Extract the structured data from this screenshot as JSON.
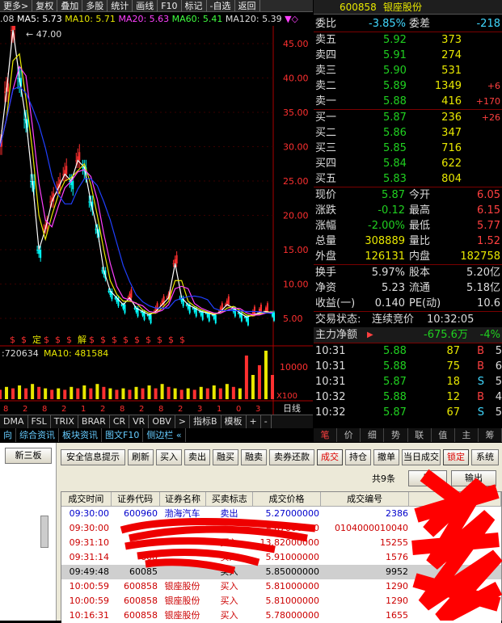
{
  "toolbar": {
    "items": [
      "更多>",
      "复权",
      "叠加",
      "多股",
      "统计",
      "画线",
      "F10",
      "标记",
      "-自选",
      "返回"
    ]
  },
  "ma_legend": {
    "prefix": ".08",
    "ma5": "MA5: 5.73",
    "ma10": "MA10: 5.71",
    "ma20": "MA20: 5.63",
    "ma60": "MA60: 5.41",
    "ma120": "MA120: 5.39"
  },
  "chart_data": {
    "type": "candlestick",
    "price_axis": {
      "ticks": [
        "45.00",
        "40.00",
        "35.00",
        "30.00",
        "25.00",
        "20.00",
        "15.00",
        "10.00",
        "5.00"
      ]
    },
    "volume_axis": {
      "ticks": [
        "10000",
        "X100"
      ]
    },
    "high_label": "47.00",
    "volume_legend": {
      "vol": "720634",
      "ma10": "MA10: 481584"
    },
    "price_path": [
      [
        0,
        30
      ],
      [
        1,
        38
      ],
      [
        2,
        47
      ],
      [
        3,
        40
      ],
      [
        4,
        34
      ],
      [
        5,
        25
      ],
      [
        6,
        15
      ],
      [
        7,
        18
      ],
      [
        8,
        22
      ],
      [
        9,
        24
      ],
      [
        10,
        26
      ],
      [
        11,
        25
      ],
      [
        12,
        28
      ],
      [
        13,
        27
      ],
      [
        14,
        22
      ],
      [
        15,
        18
      ],
      [
        16,
        12
      ],
      [
        17,
        9
      ],
      [
        18,
        8
      ],
      [
        19,
        7
      ],
      [
        20,
        8
      ],
      [
        21,
        6.5
      ],
      [
        22,
        6
      ],
      [
        23,
        5.5
      ],
      [
        24,
        6
      ],
      [
        25,
        7
      ],
      [
        26,
        8
      ],
      [
        27,
        13
      ],
      [
        28,
        8
      ],
      [
        29,
        7
      ],
      [
        30,
        6.5
      ],
      [
        31,
        6
      ],
      [
        32,
        5.8
      ],
      [
        33,
        5.5
      ],
      [
        34,
        6
      ],
      [
        35,
        7
      ],
      [
        36,
        6.5
      ],
      [
        37,
        5.8
      ],
      [
        38,
        5.2
      ],
      [
        39,
        5.5
      ],
      [
        40,
        5.8
      ],
      [
        41,
        6
      ],
      [
        42,
        5.87
      ]
    ],
    "bottom_markers": [
      "$",
      "$",
      "定",
      "$",
      "$",
      "$",
      "解",
      "$",
      "$",
      "$",
      "$",
      "$",
      "$",
      "$",
      "$",
      "$"
    ],
    "date_ticks": [
      "8",
      "2",
      "8",
      "2",
      "1",
      "2",
      "8",
      "2",
      "8",
      "2",
      "3",
      "1",
      "0",
      "3"
    ],
    "side_tick": "日线"
  },
  "indicator_tabs": [
    "DMA",
    "FSL",
    "TRIX",
    "BRAR",
    "CR",
    "VR",
    "OBV",
    ">",
    "指标B",
    "模板",
    "+",
    "-"
  ],
  "info_tabs": [
    "向",
    "综合资讯",
    "板块资讯",
    "图文F10",
    "侧边栏 «"
  ],
  "right_tabs": [
    "笔",
    "价",
    "细",
    "势",
    "联",
    "值",
    "主",
    "筹"
  ],
  "stock": {
    "code": "600858",
    "name": "银座股份"
  },
  "weibi": {
    "label": "委比",
    "value": "-3.85%",
    "label2": "委差",
    "value2": "-218"
  },
  "asks": [
    {
      "label": "卖五",
      "price": "5.92",
      "vol": "373",
      "chg": ""
    },
    {
      "label": "卖四",
      "price": "5.91",
      "vol": "274",
      "chg": ""
    },
    {
      "label": "卖三",
      "price": "5.90",
      "vol": "531",
      "chg": ""
    },
    {
      "label": "卖二",
      "price": "5.89",
      "vol": "1349",
      "chg": "+6"
    },
    {
      "label": "卖一",
      "price": "5.88",
      "vol": "416",
      "chg": "+170"
    }
  ],
  "bids": [
    {
      "label": "买一",
      "price": "5.87",
      "vol": "236",
      "chg": "+26"
    },
    {
      "label": "买二",
      "price": "5.86",
      "vol": "347",
      "chg": ""
    },
    {
      "label": "买三",
      "price": "5.85",
      "vol": "716",
      "chg": ""
    },
    {
      "label": "买四",
      "price": "5.84",
      "vol": "622",
      "chg": ""
    },
    {
      "label": "买五",
      "price": "5.83",
      "vol": "804",
      "chg": ""
    }
  ],
  "stats": [
    {
      "l1": "现价",
      "v1": "5.87",
      "l2": "今开",
      "v2": "6.05"
    },
    {
      "l1": "涨跌",
      "v1": "-0.12",
      "l2": "最高",
      "v2": "6.15"
    },
    {
      "l1": "涨幅",
      "v1": "-2.00%",
      "l2": "最低",
      "v2": "5.77"
    },
    {
      "l1": "总量",
      "v1": "308889",
      "l2": "量比",
      "v2": "1.52"
    },
    {
      "l1": "外盘",
      "v1": "126131",
      "l2": "内盘",
      "v2": "182758"
    }
  ],
  "stats2": [
    {
      "l1": "换手",
      "v1": "5.97%",
      "l2": "股本",
      "v2": "5.20亿"
    },
    {
      "l1": "净资",
      "v1": "5.23",
      "l2": "流通",
      "v2": "5.18亿"
    },
    {
      "l1": "收益(一)",
      "v1": "0.140",
      "l2": "PE(动)",
      "v2": "10.6"
    }
  ],
  "trade_status": {
    "label": "交易状态:",
    "value": "连续竞价",
    "time": "10:32:05"
  },
  "net_flow": {
    "label": "主力净额",
    "value": "-675.6万",
    "pct": "-4%"
  },
  "ticks": [
    {
      "time": "10:31",
      "price": "5.88",
      "vol": "87",
      "dir": "B",
      "n": "5"
    },
    {
      "time": "10:31",
      "price": "5.88",
      "vol": "75",
      "dir": "B",
      "n": "6"
    },
    {
      "time": "10:31",
      "price": "5.87",
      "vol": "18",
      "dir": "S",
      "n": "5"
    },
    {
      "time": "10:32",
      "price": "5.88",
      "vol": "12",
      "dir": "B",
      "n": "4"
    },
    {
      "time": "10:32",
      "price": "5.87",
      "vol": "67",
      "dir": "S",
      "n": "5"
    }
  ],
  "bottom": {
    "left_button": "新三板",
    "buttons": [
      "安全信息提示",
      "刷新",
      "买入",
      "卖出",
      "融买",
      "融卖",
      "卖券还款",
      "成交",
      "持仓",
      "撤单",
      "当日成交",
      "锁定",
      "系统"
    ],
    "count": "共9条",
    "extra_buttons": [
      "刷",
      "输出"
    ],
    "headers": [
      "成交时间",
      "证券代码",
      "证券名称",
      "买卖标志",
      "成交价格",
      "成交编号"
    ],
    "rows": [
      {
        "time": "09:30:00",
        "code": "600960",
        "name": "渤海汽车",
        "side": "卖出",
        "price": "5.27000000",
        "no": "2386"
      },
      {
        "time": "09:30:00",
        "code": "",
        "name": "",
        "side": "",
        "price": "9.67000000",
        "no": "0104000010040"
      },
      {
        "time": "09:31:10",
        "code": "",
        "name": "",
        "side": "买入",
        "price": "13.82000000",
        "no": "15255"
      },
      {
        "time": "09:31:14",
        "code": "600",
        "name": "",
        "side": "买入",
        "price": "5.91000000",
        "no": "1576"
      },
      {
        "time": "09:49:48",
        "code": "60085",
        "name": "",
        "side": "买入",
        "price": "5.85000000",
        "no": "9952"
      },
      {
        "time": "10:00:59",
        "code": "600858",
        "name": "银座股份",
        "side": "买入",
        "price": "5.81000000",
        "no": "1290"
      },
      {
        "time": "10:00:59",
        "code": "600858",
        "name": "银座股份",
        "side": "买入",
        "price": "5.81000000",
        "no": "1290"
      },
      {
        "time": "10:16:31",
        "code": "600858",
        "name": "银座股份",
        "side": "买入",
        "price": "5.78000000",
        "no": "1655"
      }
    ]
  }
}
